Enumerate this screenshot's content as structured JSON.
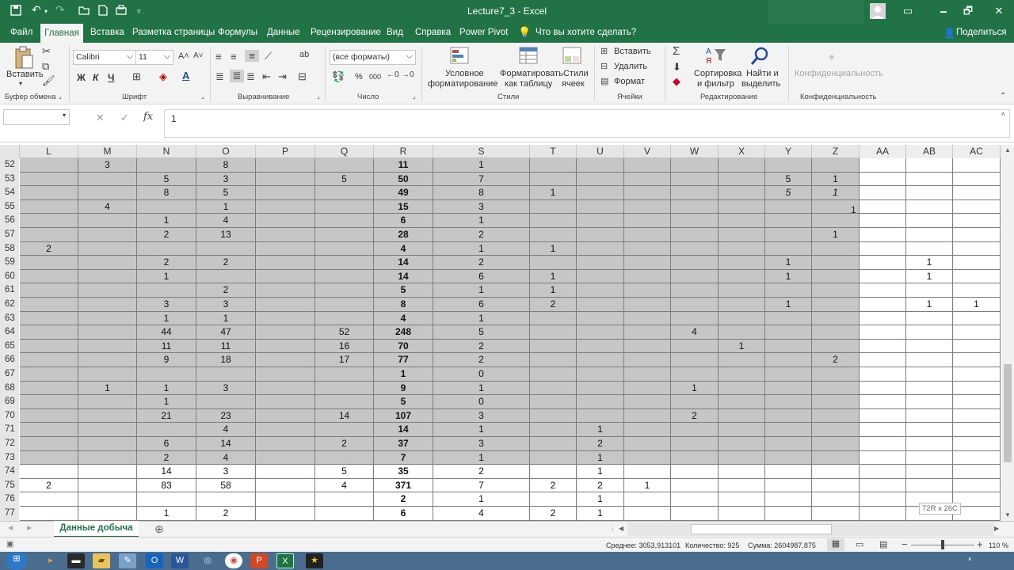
{
  "titlebar": {
    "title": "Lecture7_3  -  Excel",
    "save_icon": "floppy-disk-icon",
    "undo_icon": "undo-icon",
    "redo_icon": "redo-icon",
    "minimize": "🗕",
    "restore": "🗗",
    "close": "✕",
    "ribbon_options": "▭"
  },
  "menu": {
    "items": [
      "Файл",
      "Главная",
      "Вставка",
      "Разметка страницы",
      "Формулы",
      "Данные",
      "Рецензирование",
      "Вид",
      "Справка",
      "Power Pivot"
    ],
    "tell_me": "Что вы хотите сделать?",
    "share": "Поделиться"
  },
  "ribbon": {
    "paste": "Вставить",
    "clipboard": "Буфер обмена",
    "font_name": "Calibri",
    "font_size": "11",
    "font_group": "Шрифт",
    "bold": "Ж",
    "italic": "К",
    "underline": "Ч",
    "align_group": "Выравнивание",
    "number_format": "(все форматы)",
    "number_group": "Число",
    "percent": "%",
    "thousands": "000",
    "cond_format_1": "Условное",
    "cond_format_2": "форматирование",
    "format_table_1": "Форматировать",
    "format_table_2": "как таблицу",
    "cell_styles_1": "Стили",
    "cell_styles_2": "ячеек",
    "styles_group": "Стили",
    "insert": "Вставить",
    "delete": "Удалить",
    "format": "Формат",
    "cells_group": "Ячейки",
    "sort_1": "Сортировка",
    "sort_2": "и фильтр",
    "find_1": "Найти и",
    "find_2": "выделить",
    "editing_group": "Редактирование",
    "sensitivity": "Конфиденциальность",
    "sensitivity_group": "Конфиденциальность"
  },
  "formula_bar": {
    "name_box": "",
    "cancel": "✕",
    "enter": "✓",
    "fx": "fx",
    "value": "1"
  },
  "columns": [
    "L",
    "M",
    "N",
    "O",
    "P",
    "Q",
    "R",
    "S",
    "T",
    "U",
    "V",
    "W",
    "X",
    "Y",
    "Z",
    "AA",
    "AB",
    "AC"
  ],
  "rows": [
    {
      "n": "52",
      "c": [
        "",
        "3",
        "",
        "8",
        "",
        "",
        "11",
        "1",
        "",
        "",
        "",
        "",
        "",
        "",
        "",
        "",
        "",
        ""
      ]
    },
    {
      "n": "53",
      "c": [
        "",
        "",
        "5",
        "3",
        "",
        "5",
        "50",
        "7",
        "",
        "",
        "",
        "",
        "",
        "5",
        "1",
        "",
        "",
        ""
      ]
    },
    {
      "n": "54",
      "c": [
        "",
        "",
        "8",
        "5",
        "",
        "",
        "49",
        "8",
        "1",
        "",
        "",
        "",
        "",
        "5",
        "1",
        "",
        "",
        ""
      ]
    },
    {
      "n": "55",
      "c": [
        "",
        "4",
        "",
        "1",
        "",
        "",
        "15",
        "3",
        "",
        "",
        "",
        "",
        "",
        "",
        "",
        "",
        "",
        ""
      ]
    },
    {
      "n": "56",
      "c": [
        "",
        "",
        "1",
        "4",
        "",
        "",
        "6",
        "1",
        "",
        "",
        "",
        "",
        "",
        "",
        "",
        "",
        "",
        ""
      ]
    },
    {
      "n": "57",
      "c": [
        "",
        "",
        "2",
        "13",
        "",
        "",
        "28",
        "2",
        "",
        "",
        "",
        "",
        "",
        "",
        "1",
        "",
        "",
        ""
      ]
    },
    {
      "n": "58",
      "c": [
        "2",
        "",
        "",
        "",
        "",
        "",
        "4",
        "1",
        "1",
        "",
        "",
        "",
        "",
        "",
        "",
        "",
        "",
        ""
      ]
    },
    {
      "n": "59",
      "c": [
        "",
        "",
        "2",
        "2",
        "",
        "",
        "14",
        "2",
        "",
        "",
        "",
        "",
        "",
        "1",
        "",
        "",
        "1",
        ""
      ]
    },
    {
      "n": "60",
      "c": [
        "",
        "",
        "1",
        "",
        "",
        "",
        "14",
        "6",
        "1",
        "",
        "",
        "",
        "",
        "1",
        "",
        "",
        "1",
        ""
      ]
    },
    {
      "n": "61",
      "c": [
        "",
        "",
        "",
        "2",
        "",
        "",
        "5",
        "1",
        "1",
        "",
        "",
        "",
        "",
        "",
        "",
        "",
        "",
        ""
      ]
    },
    {
      "n": "62",
      "c": [
        "",
        "",
        "3",
        "3",
        "",
        "",
        "8",
        "6",
        "2",
        "",
        "",
        "",
        "",
        "1",
        "",
        "",
        "1",
        "1"
      ]
    },
    {
      "n": "63",
      "c": [
        "",
        "",
        "1",
        "1",
        "",
        "",
        "4",
        "1",
        "",
        "",
        "",
        "",
        "",
        "",
        "",
        "",
        "",
        ""
      ]
    },
    {
      "n": "64",
      "c": [
        "",
        "",
        "44",
        "47",
        "",
        "52",
        "248",
        "5",
        "",
        "",
        "",
        "4",
        "",
        "",
        "",
        "",
        "",
        ""
      ]
    },
    {
      "n": "65",
      "c": [
        "",
        "",
        "11",
        "11",
        "",
        "16",
        "70",
        "2",
        "",
        "",
        "",
        "",
        "1",
        "",
        "",
        "",
        "",
        ""
      ]
    },
    {
      "n": "66",
      "c": [
        "",
        "",
        "9",
        "18",
        "",
        "17",
        "77",
        "2",
        "",
        "",
        "",
        "",
        "",
        "",
        "2",
        "",
        "",
        ""
      ]
    },
    {
      "n": "67",
      "c": [
        "",
        "",
        "",
        "",
        "",
        "",
        "1",
        "0",
        "",
        "",
        "",
        "",
        "",
        "",
        "",
        "",
        "",
        ""
      ]
    },
    {
      "n": "68",
      "c": [
        "",
        "1",
        "1",
        "3",
        "",
        "",
        "9",
        "1",
        "",
        "",
        "",
        "1",
        "",
        "",
        "",
        "",
        "",
        ""
      ]
    },
    {
      "n": "69",
      "c": [
        "",
        "",
        "1",
        "",
        "",
        "",
        "5",
        "0",
        "",
        "",
        "",
        "",
        "",
        "",
        "",
        "",
        "",
        ""
      ]
    },
    {
      "n": "70",
      "c": [
        "",
        "",
        "21",
        "23",
        "",
        "14",
        "107",
        "3",
        "",
        "",
        "",
        "2",
        "",
        "",
        "",
        "",
        "",
        ""
      ]
    },
    {
      "n": "71",
      "c": [
        "",
        "",
        "",
        "4",
        "",
        "",
        "14",
        "1",
        "",
        "1",
        "",
        "",
        "",
        "",
        "",
        "",
        "",
        ""
      ]
    },
    {
      "n": "72",
      "c": [
        "",
        "",
        "6",
        "14",
        "",
        "2",
        "37",
        "3",
        "",
        "2",
        "",
        "",
        "",
        "",
        "",
        "",
        "",
        ""
      ]
    },
    {
      "n": "73",
      "c": [
        "",
        "",
        "2",
        "4",
        "",
        "",
        "7",
        "1",
        "",
        "1",
        "",
        "",
        "",
        "",
        "",
        "",
        "",
        ""
      ]
    },
    {
      "n": "74",
      "c": [
        "",
        "",
        "14",
        "3",
        "",
        "5",
        "35",
        "2",
        "",
        "1",
        "",
        "",
        "",
        "",
        "",
        "",
        "",
        ""
      ]
    },
    {
      "n": "75",
      "c": [
        "2",
        "",
        "83",
        "58",
        "",
        "4",
        "371",
        "7",
        "2",
        "2",
        "1",
        "",
        "",
        "",
        "",
        "",
        "",
        ""
      ]
    },
    {
      "n": "76",
      "c": [
        "",
        "",
        "",
        "",
        "",
        "",
        "2",
        "1",
        "",
        "1",
        "",
        "",
        "",
        "",
        "",
        "",
        "",
        ""
      ]
    },
    {
      "n": "77",
      "c": [
        "",
        "",
        "1",
        "2",
        "",
        "",
        "6",
        "4",
        "2",
        "1",
        "",
        "",
        "",
        "",
        "",
        "",
        "",
        ""
      ]
    }
  ],
  "overflow_55_z": "1",
  "selection_tooltip": "72R x 26C",
  "sheet_tab": "Данные добыча",
  "add_sheet": "⊕",
  "status": {
    "average": "Среднее: 3053,913101",
    "count": "Количество: 925",
    "sum": "Сумма: 2604987,875",
    "zoom": "110 %",
    "minus": "−",
    "plus": "+"
  },
  "taskbar_icons": [
    "start-icon",
    "media-player-icon",
    "terminal-icon",
    "folder-icon",
    "paint-icon",
    "outlook-icon",
    "word-icon",
    "network-icon",
    "chrome-icon",
    "powerpoint-icon",
    "excel-icon",
    "movie-maker-icon"
  ]
}
